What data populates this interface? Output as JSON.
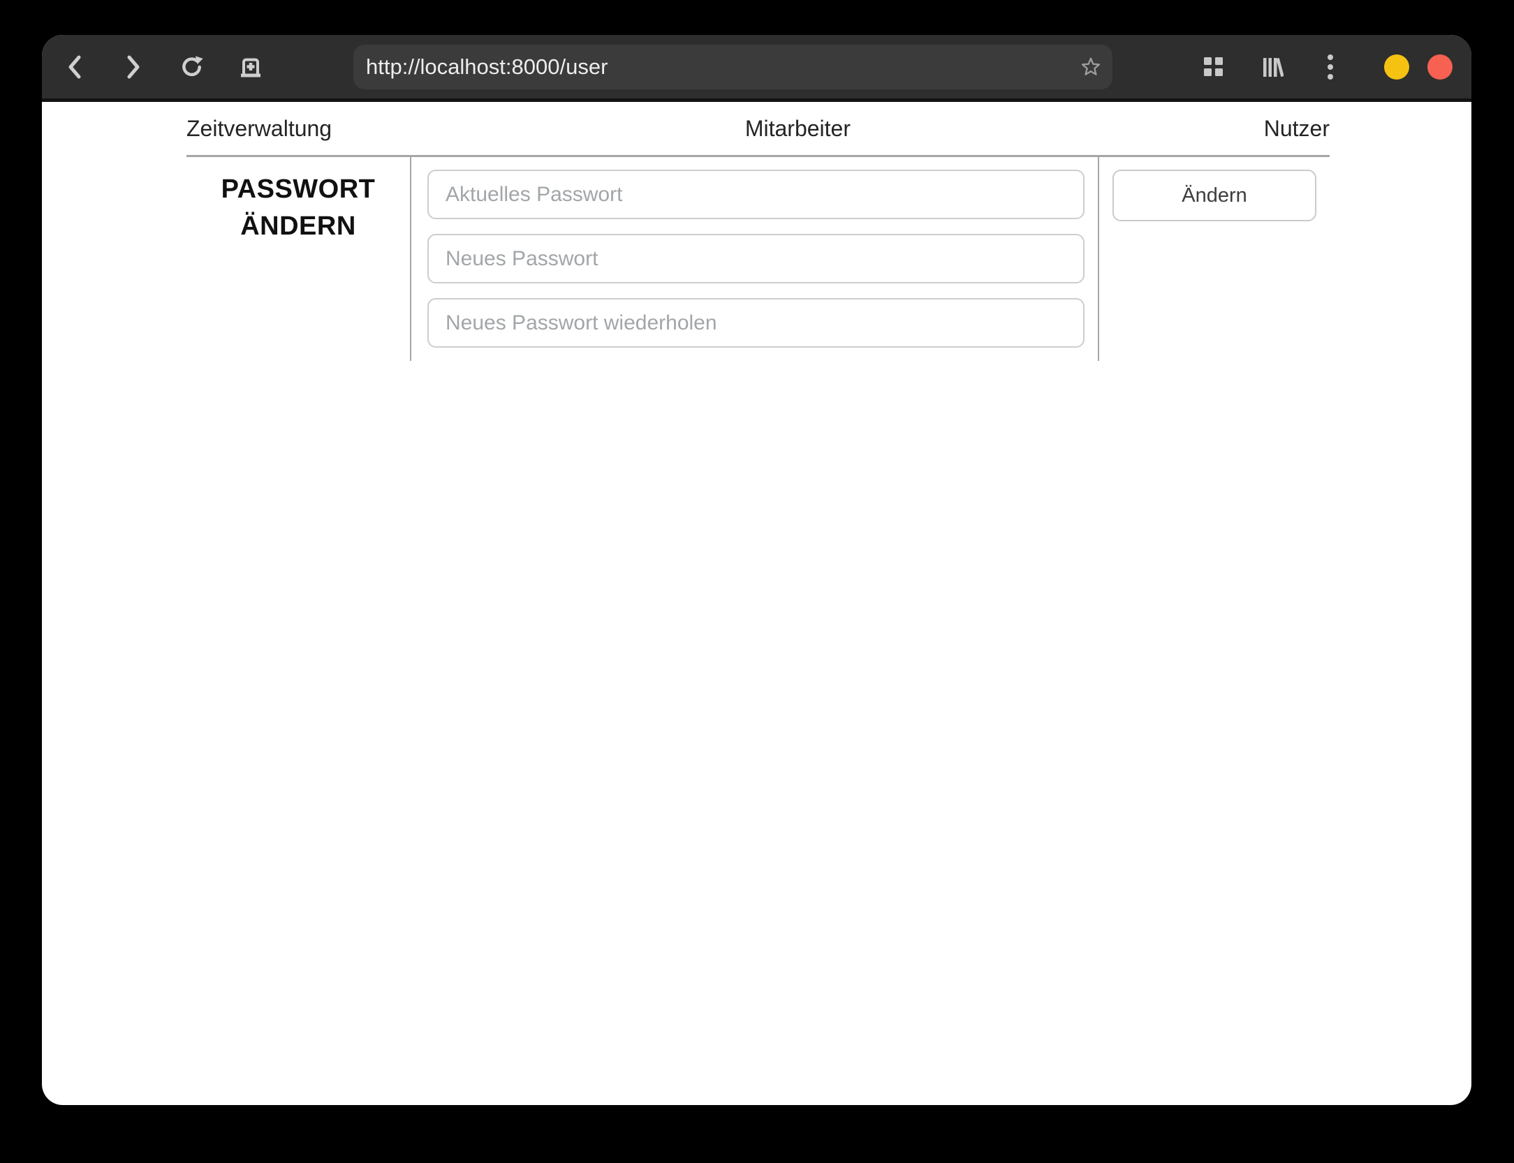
{
  "browser": {
    "url_bar": {
      "value": "http://localhost:8000/user"
    },
    "toolbar_icons": [
      "back",
      "forward",
      "reload",
      "new-tab",
      "bookmark-star",
      "tabs-grid",
      "library",
      "menu"
    ],
    "window_controls": [
      {
        "name": "minimize",
        "color": "#f5c211"
      },
      {
        "name": "close",
        "color": "#f66151"
      }
    ]
  },
  "nav": {
    "items": [
      {
        "label": "Zeitverwaltung"
      },
      {
        "label": "Mitarbeiter"
      },
      {
        "label": "Nutzer"
      }
    ]
  },
  "password_form": {
    "heading": "PASSWORT ÄNDERN",
    "fields": [
      {
        "placeholder": "Aktuelles Passwort",
        "value": ""
      },
      {
        "placeholder": "Neues Passwort",
        "value": ""
      },
      {
        "placeholder": "Neues Passwort wiederholen",
        "value": ""
      }
    ],
    "submit_label": "Ändern"
  },
  "colors": {
    "toolbar_bg": "#2e2e2e",
    "urlbar_bg": "#3b3b3b",
    "toolbar_icon": "#cfcfcf",
    "table_border": "#a6a6a6",
    "input_border": "#cdcdcd",
    "placeholder_text": "#a2a6a9",
    "minimize_button": "#f5c211",
    "close_button": "#f66151"
  }
}
